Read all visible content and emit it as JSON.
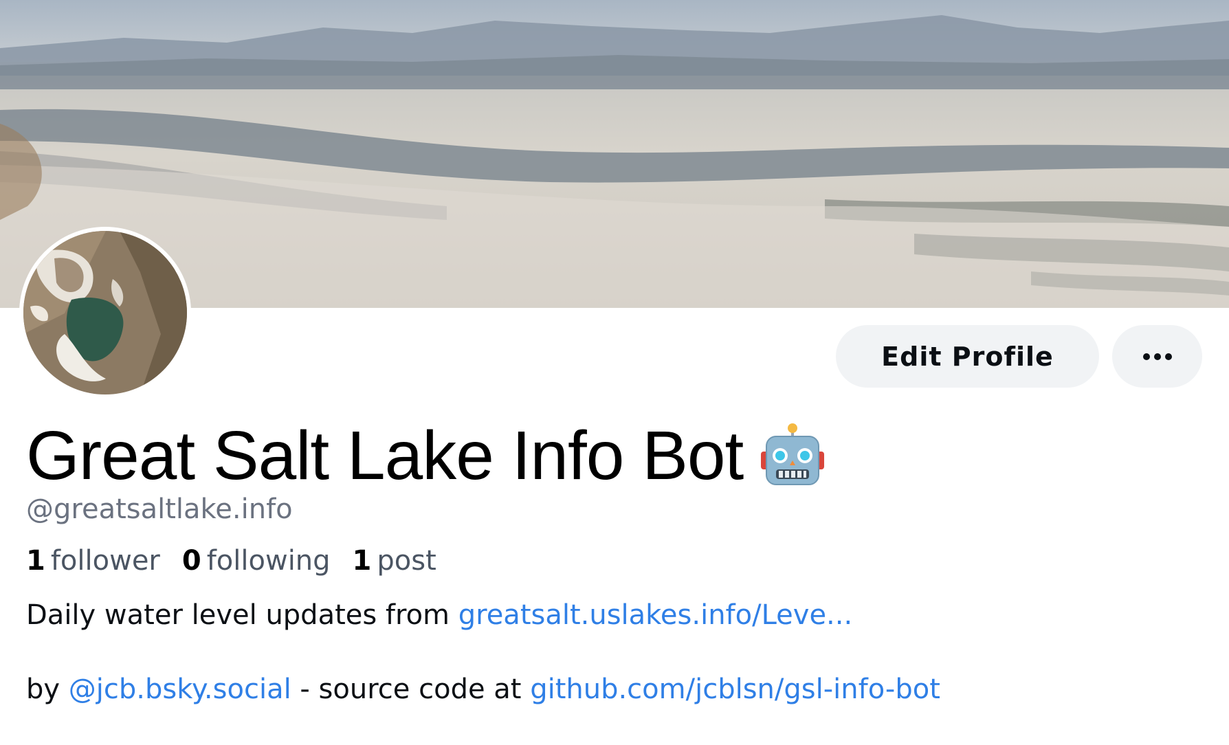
{
  "banner": {
    "description_icon": "banner-image"
  },
  "avatar": {
    "icon": "avatar-image"
  },
  "actions": {
    "edit_profile_label": "Edit Profile",
    "more_icon": "ellipsis-icon"
  },
  "profile": {
    "display_name": "Great Salt Lake Info Bot",
    "name_emoji_icon": "robot-icon",
    "handle": "@greatsaltlake.info"
  },
  "stats": {
    "followers_count": "1",
    "followers_label": "follower",
    "following_count": "0",
    "following_label": "following",
    "posts_count": "1",
    "posts_label": "post"
  },
  "bio": {
    "line1_text": "Daily water level updates from ",
    "line1_link": "greatsalt.uslakes.info/Leve...",
    "line2_prefix": "by ",
    "line2_mention": "@jcb.bsky.social",
    "line2_middle": " - source code at ",
    "line2_link": "github.com/jcblsn/gsl-info-bot"
  },
  "colors": {
    "link": "#2f7fe6",
    "muted": "#6b7280",
    "button_bg": "#f1f3f5"
  }
}
